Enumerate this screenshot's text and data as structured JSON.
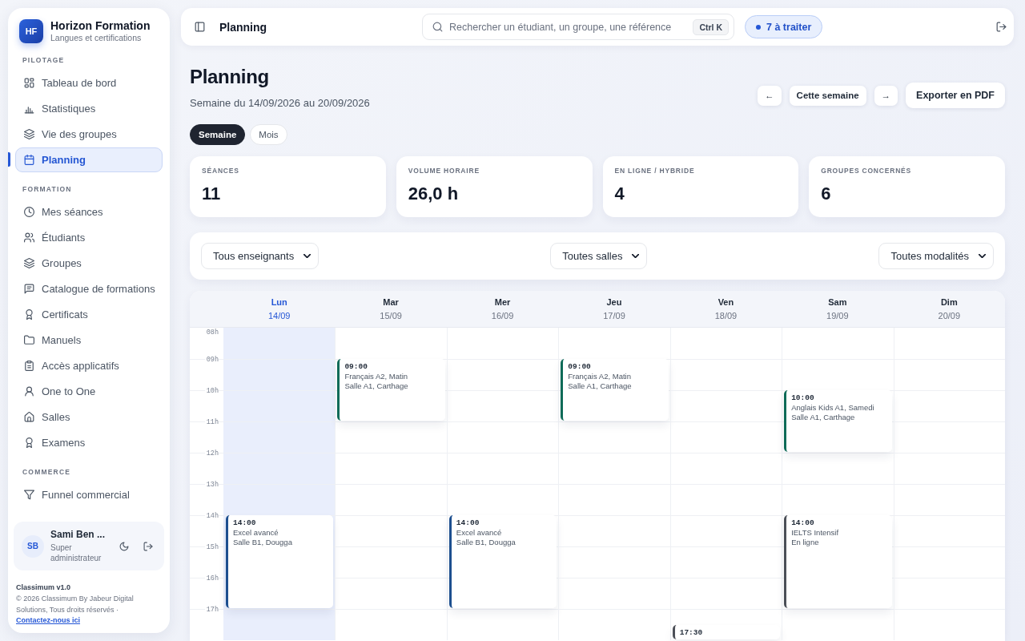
{
  "sidebar": {
    "brand": {
      "logo": "HF",
      "name": "Horizon Formation",
      "tagline": "Langues et certifications"
    },
    "sections": [
      {
        "title": "PILOTAGE",
        "items": [
          {
            "label": "Tableau de bord",
            "selected": false
          },
          {
            "label": "Statistiques",
            "selected": false
          },
          {
            "label": "Vie des groupes",
            "selected": false
          },
          {
            "label": "Planning",
            "selected": true
          }
        ]
      },
      {
        "title": "FORMATION",
        "items": [
          {
            "label": "Mes séances",
            "selected": false
          },
          {
            "label": "Étudiants",
            "selected": false
          },
          {
            "label": "Groupes",
            "selected": false
          },
          {
            "label": "Catalogue de formations",
            "selected": false
          },
          {
            "label": "Certificats",
            "selected": false
          },
          {
            "label": "Manuels",
            "selected": false
          },
          {
            "label": "Accès applicatifs",
            "selected": false
          },
          {
            "label": "One to One",
            "selected": false
          },
          {
            "label": "Salles",
            "selected": false
          },
          {
            "label": "Examens",
            "selected": false
          }
        ]
      },
      {
        "title": "COMMERCE",
        "items": [
          {
            "label": "Funnel commercial",
            "selected": false
          }
        ]
      }
    ],
    "user": {
      "initials": "SB",
      "name": "Sami Ben ...",
      "role": "Super administrateur"
    },
    "footer": {
      "version": "Classimum v1.0",
      "copyright": "© 2026 Classimum By Jabeur Digital Solutions, Tous droits réservés ·",
      "link": "Contactez-nous ici"
    }
  },
  "topbar": {
    "title": "Planning",
    "search": {
      "placeholder": "Rechercher un étudiant, un groupe, une référence",
      "shortcut": "Ctrl K"
    },
    "badge": "7 à traiter"
  },
  "page": {
    "title": "Planning",
    "subtitle": "Semaine du 14/09/2026 au 20/09/2026",
    "actions": [
      {
        "label": "←",
        "kind": "small"
      },
      {
        "label": "Cette semaine",
        "kind": "small"
      },
      {
        "label": "→",
        "kind": "small"
      },
      {
        "label": "Exporter en PDF",
        "kind": "large"
      }
    ]
  },
  "view_tabs": [
    {
      "label": "Semaine",
      "selected": true
    },
    {
      "label": "Mois",
      "selected": false
    }
  ],
  "stats": [
    {
      "label": "SÉANCES",
      "value": "11"
    },
    {
      "label": "VOLUME HORAIRE",
      "value": "26,0 h"
    },
    {
      "label": "EN LIGNE / HYBRIDE",
      "value": "4"
    },
    {
      "label": "GROUPES CONCERNÉS",
      "value": "6"
    }
  ],
  "filters": [
    "Tous enseignants",
    "Toutes salles",
    "Toutes modalités"
  ],
  "calendar": {
    "hours": [
      "08h",
      "09h",
      "10h",
      "11h",
      "12h",
      "13h",
      "14h",
      "15h",
      "16h",
      "17h"
    ],
    "days": [
      {
        "name": "Lun",
        "date": "14/09",
        "today": true,
        "events": [
          {
            "time": "14:00",
            "title": "Excel avancé",
            "location": "Salle B1, Dougga",
            "color": "#1d4f8f",
            "kind": "long"
          }
        ]
      },
      {
        "name": "Mar",
        "date": "15/09",
        "today": false,
        "events": [
          {
            "time": "09:00",
            "title": "Français A2, Matin",
            "location": "Salle A1, Carthage",
            "color": "#0e6b58",
            "kind": "short"
          }
        ]
      },
      {
        "name": "Mer",
        "date": "16/09",
        "today": false,
        "events": [
          {
            "time": "14:00",
            "title": "Excel avancé",
            "location": "Salle B1, Dougga",
            "color": "#1d4f8f",
            "kind": "long"
          }
        ]
      },
      {
        "name": "Jeu",
        "date": "17/09",
        "today": false,
        "events": [
          {
            "time": "09:00",
            "title": "Français A2, Matin",
            "location": "Salle A1, Carthage",
            "color": "#0e6b58",
            "kind": "short"
          }
        ]
      },
      {
        "name": "Ven",
        "date": "18/09",
        "today": false,
        "events": [
          {
            "time": "17:30",
            "color": "#4b4f57",
            "kind": "long"
          }
        ]
      },
      {
        "name": "Sam",
        "date": "19/09",
        "today": false,
        "events": [
          {
            "time": "10:00",
            "title": "Anglais Kids A1, Samedi",
            "location": "Salle A1, Carthage",
            "color": "#0e6b58",
            "kind": "short"
          },
          {
            "time": "14:00",
            "title": "IELTS Intensif",
            "location": "En ligne",
            "color": "#4b4f57",
            "kind": "long"
          }
        ]
      },
      {
        "name": "Dim",
        "date": "20/09",
        "today": false
      }
    ]
  }
}
